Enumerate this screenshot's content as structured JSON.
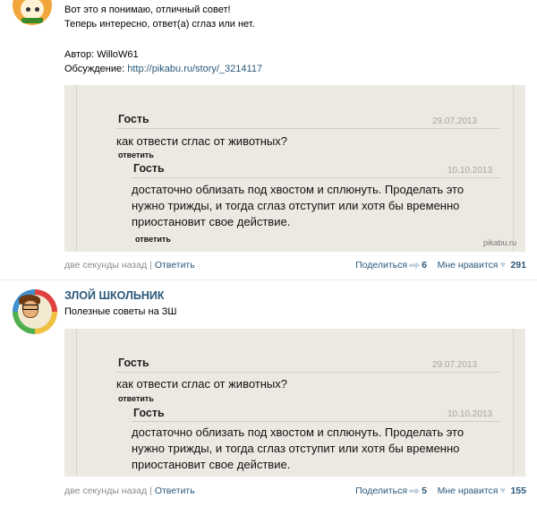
{
  "post1": {
    "lines": [
      "Вот это я понимаю, отличный совет!",
      "Теперь интересно, ответ(а) сглаз или нет."
    ],
    "author_label": "Автор: WilloW61",
    "discussion_label": "Обсуждение:",
    "discussion_link": "http://pikabu.ru/story/_3214117",
    "footer": {
      "time": "две секунды назад",
      "reply": "Ответить",
      "share": "Поделиться",
      "share_count": "6",
      "like": "Мне нравится",
      "like_count": "291"
    }
  },
  "post2": {
    "author": "ЗЛОЙ ШКОЛЬНИК",
    "subtitle": "Полезные советы на ЗШ",
    "footer": {
      "time": "две секунды назад",
      "reply": "Ответить",
      "share": "Поделиться",
      "share_count": "5",
      "like": "Мне нравится",
      "like_count": "155"
    }
  },
  "image": {
    "guest": "Гость",
    "date1": "29.07.2013",
    "question": "как отвести сглас от животных?",
    "reply_link": "ответить",
    "date2": "10.10.2013",
    "answer": "достаточно облизать под хвостом и сплюнуть. Проделать это нужно трижды, и тогда сглаз отступит или хотя бы временно приостановит свое действие.",
    "watermark": "pikabu.ru"
  }
}
